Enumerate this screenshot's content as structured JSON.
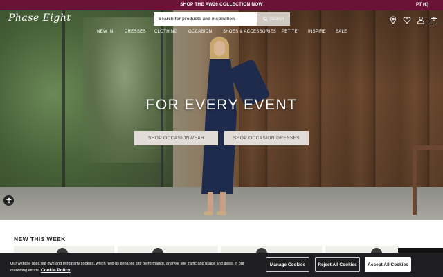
{
  "promo": {
    "text": "SHOP THE AW26 COLLECTION NOW",
    "region": "PT (€)"
  },
  "header": {
    "logo_text": "Phase Eight",
    "search": {
      "placeholder": "Search for products and inspiration",
      "button_label": "Search"
    },
    "nav": [
      "NEW IN",
      "DRESSES",
      "CLOTHING",
      "OCCASION",
      "SHOES & ACCESSORIES",
      "PETITE",
      "INSPIRE",
      "SALE"
    ],
    "icons": [
      "location-icon",
      "heart-icon",
      "account-icon",
      "bag-icon"
    ],
    "bag_count": "0"
  },
  "hero": {
    "title": "FOR EVERY EVENT",
    "buttons": [
      "SHOP OCCASIONWEAR",
      "SHOP OCCASION DRESSES"
    ]
  },
  "new_this_week": {
    "title": "NEW THIS WEEK"
  },
  "cookie": {
    "text": "Our website uses our own and third party cookies, which help us enhance site performance, analyse site traffic and usage and assist in our marketing efforts.",
    "policy_link": "Cookie Policy",
    "manage_label": "Manage Cookies",
    "reject_label": "Reject All Cookies",
    "accept_label": "Accept All Cookies"
  },
  "colors": {
    "promo_bg": "#6b1238",
    "cookie_bg": "#1f1f21",
    "hero_button_bg": "#e2dcd6"
  }
}
